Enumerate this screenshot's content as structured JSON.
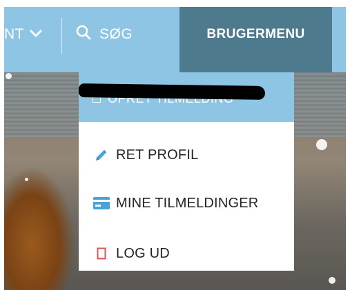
{
  "nav": {
    "partial_left_label": "NT",
    "search_label": "SØG",
    "user_menu_label": "BRUGERMENU"
  },
  "dropdown": {
    "header_label": "OPRET TILMELDING",
    "items": [
      {
        "label": "RET PROFIL",
        "icon": "pencil-icon"
      },
      {
        "label": "MINE TILMELDINGER",
        "icon": "credit-card-icon"
      },
      {
        "label": "LOG UD",
        "icon": "logout-icon"
      }
    ]
  },
  "colors": {
    "nav_bg": "#8fc5e4",
    "user_menu_bg": "#4e7a8e",
    "icon_blue": "#4aa3d8",
    "logout_red": "#e05050"
  }
}
